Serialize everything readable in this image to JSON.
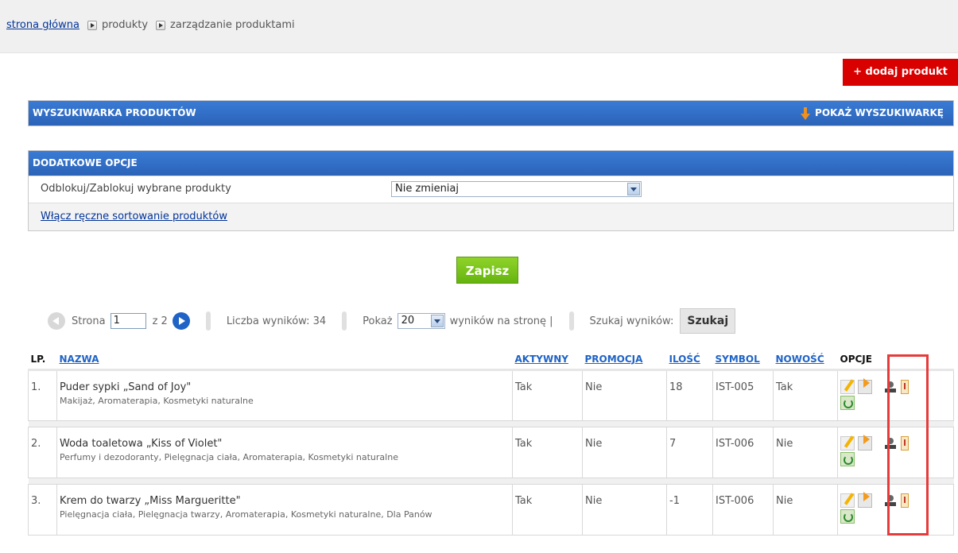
{
  "breadcrumb": {
    "home": "strona główna",
    "level1": "produkty",
    "level2": "zarządzanie produktami"
  },
  "add_button": "+ dodaj produkt",
  "search_panel": {
    "title": "WYSZUKIWARKA PRODUKTÓW",
    "toggle": "POKAŻ WYSZUKIWARKĘ"
  },
  "options_panel": {
    "title": "DODATKOWE OPCJE",
    "block_label": "Odblokuj/Zablokuj wybrane produkty",
    "block_select": "Nie zmieniaj",
    "manual_sort": "Włącz ręczne sortowanie produktów"
  },
  "save_button": "Zapisz",
  "pager": {
    "page_label": "Strona",
    "page_value": "1",
    "of_label": "z 2",
    "results_label": "Liczba wyników: 34",
    "show_label": "Pokaż",
    "per_page": "20",
    "per_page_suffix": "wyników na stronę |",
    "search_results_label": "Szukaj wyników:",
    "search_button": "Szukaj"
  },
  "table": {
    "headers": {
      "lp": "LP.",
      "name": "NAZWA",
      "active": "AKTYWNY",
      "promo": "PROMOCJA",
      "qty": "ILOŚĆ",
      "symbol": "SYMBOL",
      "new": "NOWOŚĆ",
      "options": "OPCJE"
    },
    "rows": [
      {
        "lp": "1.",
        "name": "Puder sypki „Sand of Joy\"",
        "categories": "Makijaż, Aromaterapia, Kosmetyki naturalne",
        "active": "Tak",
        "promo": "Nie",
        "qty": "18",
        "symbol": "IST-005",
        "new": "Tak"
      },
      {
        "lp": "2.",
        "name": "Woda toaletowa „Kiss of Violet\"",
        "categories": "Perfumy i dezodoranty, Pielęgnacja ciała, Aromaterapia, Kosmetyki naturalne",
        "active": "Tak",
        "promo": "Nie",
        "qty": "7",
        "symbol": "IST-006",
        "new": "Nie"
      },
      {
        "lp": "3.",
        "name": "Krem do twarzy „Miss Margueritte\"",
        "categories": "Pielęgnacja ciała, Pielęgnacja twarzy, Aromaterapia, Kosmetyki naturalne, Dla Panów",
        "active": "Tak",
        "promo": "Nie",
        "qty": "-1",
        "symbol": "IST-006",
        "new": "Nie"
      }
    ]
  },
  "colors": {
    "header_blue": "#2b63b8",
    "add_red": "#d90000",
    "save_green": "#66b40f",
    "highlight": "#e63b3b",
    "link": "#003399"
  }
}
